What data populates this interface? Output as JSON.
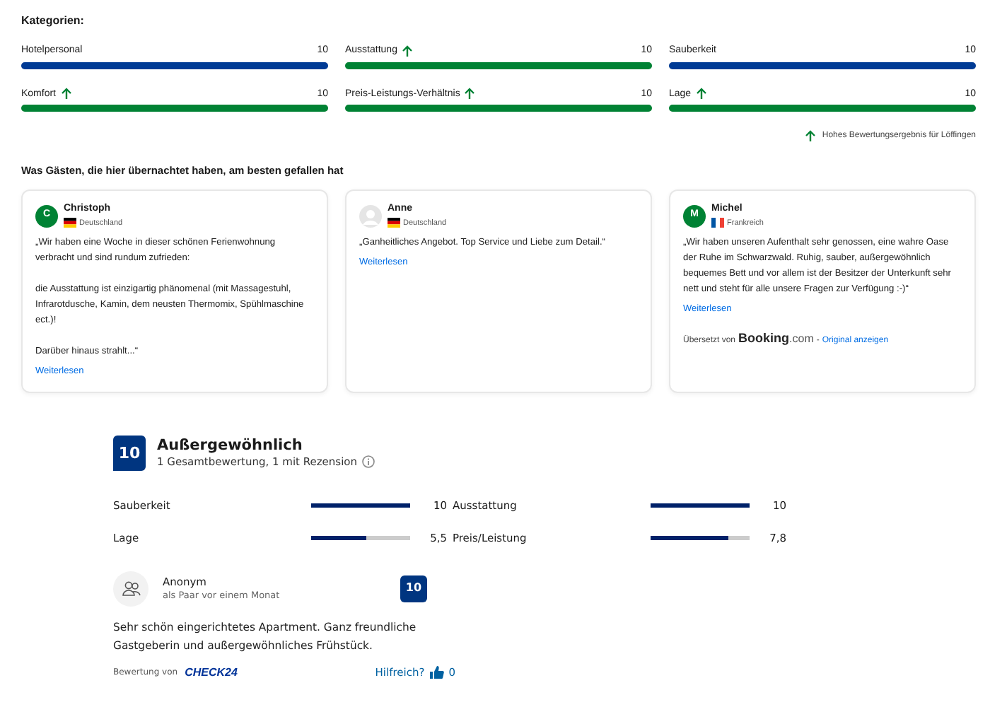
{
  "categories_title": "Kategorien:",
  "categories": [
    {
      "label": "Hotelpersonal",
      "value": "10",
      "level": 1,
      "high": false
    },
    {
      "label": "Ausstattung",
      "value": "10",
      "level": 1,
      "high": true
    },
    {
      "label": "Sauberkeit",
      "value": "10",
      "level": 1,
      "high": false
    },
    {
      "label": "Komfort",
      "value": "10",
      "level": 1,
      "high": true
    },
    {
      "label": "Preis-Leistungs-Verhältnis",
      "value": "10",
      "level": 1,
      "high": true
    },
    {
      "label": "Lage",
      "value": "10",
      "level": 1,
      "high": true
    }
  ],
  "high_score_note": "Hohes Bewertungsergebnis für Löffingen",
  "reviews_title": "Was Gästen, die hier übernachtet haben, am besten gefallen hat",
  "reviews": [
    {
      "name": "Christoph",
      "avatar": {
        "kind": "letter",
        "letter": "C",
        "color": "#008234"
      },
      "flag": {
        "kind": "german"
      },
      "country": "Deutschland",
      "paragraphs": [
        "„Wir haben eine Woche in dieser schönen Ferienwohnung verbracht und sind rundum zufrieden:",
        "die Ausstattung ist einzigartig phänomenal (mit Massagestuhl, Infrarotdusche, Kamin, dem neusten Thermomix, Spühlmaschine ect.)!",
        "Darüber hinaus strahlt...“"
      ],
      "link": "Weiterlesen"
    },
    {
      "name": "Anne",
      "avatar": {
        "kind": "blank"
      },
      "flag": {
        "kind": "german"
      },
      "country": "Deutschland",
      "paragraphs": [
        "„Ganheitliches Angebot. Top Service und Liebe zum Detail.“"
      ],
      "link": "Weiterlesen"
    },
    {
      "name": "Michel",
      "avatar": {
        "kind": "letter",
        "letter": "M",
        "color": "#008234"
      },
      "flag": {
        "kind": "french"
      },
      "country": "Frankreich",
      "paragraphs": [
        "„Wir haben unseren Aufenthalt sehr genossen, eine wahre Oase der Ruhe im Schwarzwald. Ruhig, sauber, außergewöhnlich bequemes Bett und vor allem ist der Besitzer der Unterkunft sehr nett und steht für alle unsere Fragen zur Verfügung :-)“"
      ],
      "link": "Weiterlesen",
      "translation": {
        "label": "Übersetzt von",
        "brand": "Booking",
        "brand_suffix": ".com",
        "separator": "-",
        "link": "Original anzeigen"
      }
    }
  ],
  "summary": {
    "score": "10",
    "title": "Außergewöhnlich",
    "subtitle": "1 Gesamtbewertung, 1 mit Rezension",
    "ratings": [
      {
        "label": "Sauberkeit",
        "value": "10",
        "level": 1
      },
      {
        "label": "Ausstattung",
        "value": "10",
        "level": 1
      },
      {
        "label": "Lage",
        "value": "5,5",
        "level": 0.55
      },
      {
        "label": "Preis/Leistung",
        "value": "7,8",
        "level": 0.78
      }
    ]
  },
  "review": {
    "author": "Anonym",
    "meta": "als Paar vor einem Monat",
    "score": "10",
    "text": "Sehr schön eingerichtetes Apartment. Ganz freundliche Gastgeberin und außergewöhnliches Frühstück.",
    "source_label": "Bewertung von",
    "source": "CHECK24",
    "helpful": "Hilfreich?",
    "helpful_count": "0"
  }
}
